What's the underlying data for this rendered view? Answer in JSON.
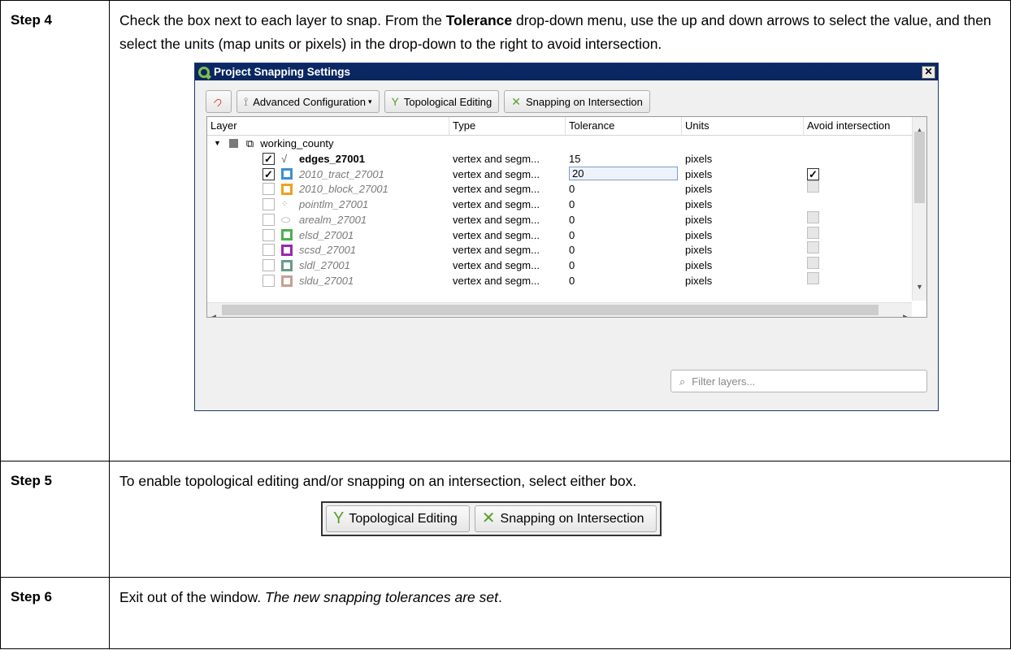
{
  "steps": {
    "s4": {
      "label": "Step 4",
      "text_before": "Check the box next to each layer to snap. From the ",
      "text_bold": "Tolerance",
      "text_after": " drop-down menu, use the up and down arrows to select the value, and then select the units (map units or pixels) in the drop-down to the right to avoid intersection."
    },
    "s5": {
      "label": "Step 5",
      "text": "To enable topological editing and/or snapping on an intersection, select either box."
    },
    "s6": {
      "label": "Step 6",
      "text_plain": "Exit out of the window. ",
      "text_italic": "The new snapping tolerances are set",
      "text_end": "."
    }
  },
  "dialog": {
    "title": "Project Snapping Settings",
    "close": "✕",
    "toolbar": {
      "advanced": "Advanced Configuration",
      "topological": "Topological Editing",
      "intersection": "Snapping on Intersection"
    },
    "columns": [
      "Layer",
      "Type",
      "Tolerance",
      "Units",
      "Avoid intersection"
    ],
    "group": "working_county",
    "rows": [
      {
        "name": "edges_27001",
        "type": "vertex and segm...",
        "tolerance": "15",
        "units": "pixels",
        "checked": true,
        "avoid": "none",
        "icon": "line",
        "iconColor": "#555555"
      },
      {
        "name": "2010_tract_27001",
        "type": "vertex and segm...",
        "tolerance": "20",
        "units": "pixels",
        "checked": true,
        "avoid": "checked",
        "icon": "square",
        "iconColor": "#3b8fd6"
      },
      {
        "name": "2010_block_27001",
        "type": "vertex and segm...",
        "tolerance": "0",
        "units": "pixels",
        "checked": false,
        "avoid": "grey",
        "icon": "square",
        "iconColor": "#f0a020"
      },
      {
        "name": "pointlm_27001",
        "type": "vertex and segm...",
        "tolerance": "0",
        "units": "pixels",
        "checked": false,
        "avoid": "none",
        "icon": "point",
        "iconColor": "#888888"
      },
      {
        "name": "arealm_27001",
        "type": "vertex and segm...",
        "tolerance": "0",
        "units": "pixels",
        "checked": false,
        "avoid": "grey",
        "icon": "area",
        "iconColor": "#999999"
      },
      {
        "name": "elsd_27001",
        "type": "vertex and segm...",
        "tolerance": "0",
        "units": "pixels",
        "checked": false,
        "avoid": "grey",
        "icon": "square",
        "iconColor": "#4caf50"
      },
      {
        "name": "scsd_27001",
        "type": "vertex and segm...",
        "tolerance": "0",
        "units": "pixels",
        "checked": false,
        "avoid": "grey",
        "icon": "square",
        "iconColor": "#9c27b0"
      },
      {
        "name": "sldl_27001",
        "type": "vertex and segm...",
        "tolerance": "0",
        "units": "pixels",
        "checked": false,
        "avoid": "grey",
        "icon": "square",
        "iconColor": "#6a9a8a"
      },
      {
        "name": "sldu_27001",
        "type": "vertex and segm...",
        "tolerance": "0",
        "units": "pixels",
        "checked": false,
        "avoid": "grey",
        "icon": "square",
        "iconColor": "#c8a090"
      }
    ],
    "filter_placeholder": "Filter layers..."
  },
  "button_pair": {
    "topological": "Topological Editing",
    "intersection": "Snapping on Intersection"
  }
}
